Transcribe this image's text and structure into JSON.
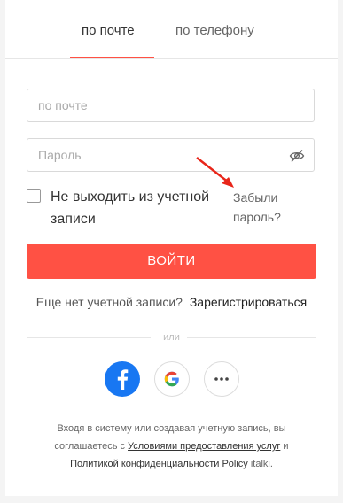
{
  "tabs": {
    "email": "по почте",
    "phone": "по телефону"
  },
  "form": {
    "email_placeholder": "по почте",
    "password_placeholder": "Пароль",
    "remember_label": "Не выходить из учетной записи",
    "forgot_label": "Забыли пароль?",
    "login_label": "ВОЙТИ"
  },
  "signup": {
    "question": "Еще нет учетной записи?",
    "link": "Зарегистрироваться"
  },
  "divider_text": "или",
  "social": {
    "icons": [
      "facebook-icon",
      "google-icon",
      "more-icon"
    ]
  },
  "terms": {
    "part1": "Входя в систему или создавая учетную запись, вы соглашаетесь с",
    "link1": "Условиями предоставления услуг",
    "part2": "и",
    "link2": "Политикой конфиденциальности Policy",
    "part3": "italki."
  },
  "colors": {
    "accent": "#ff5144",
    "facebook": "#1877f2"
  }
}
